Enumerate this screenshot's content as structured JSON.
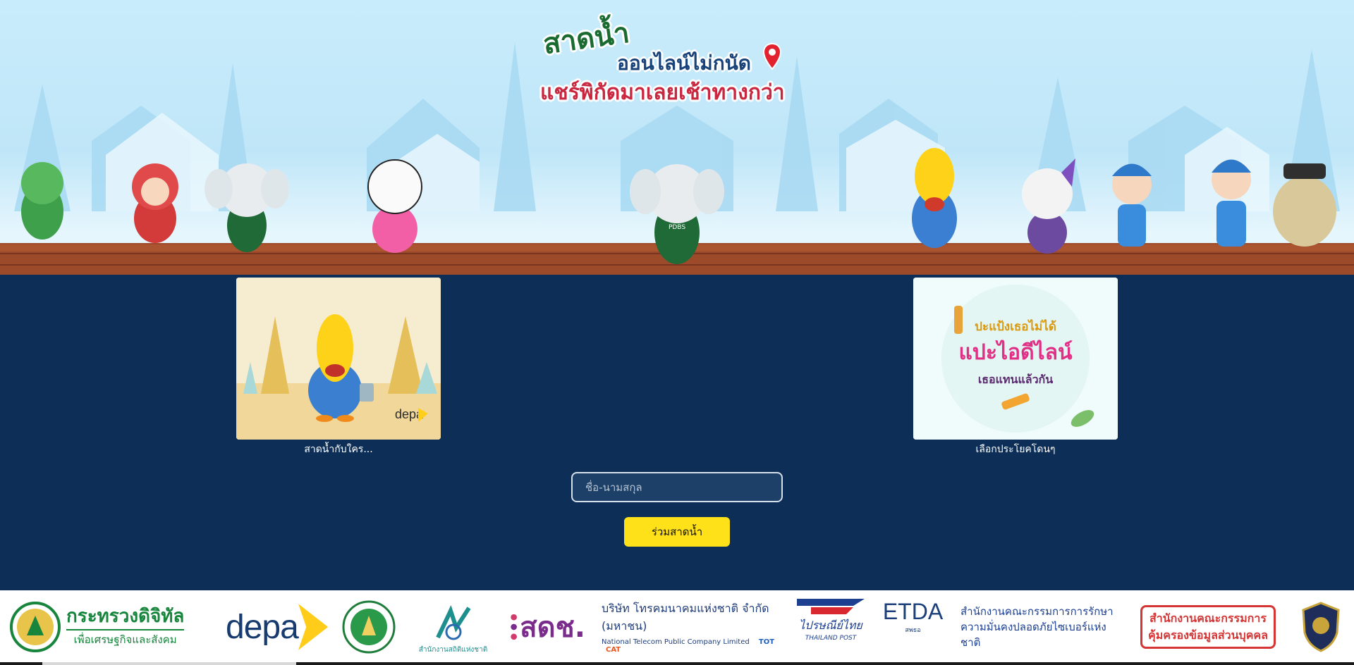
{
  "banner": {
    "title_line_1": "สาดน้ำ",
    "title_line_2": "ออนไลน์ไม่กนัด",
    "title_line_3": "แชร์พิกัดมาเลยเช้าทางกว่า",
    "pin_icon": "location-pin-icon",
    "mascot_badge": "PDBS"
  },
  "cards": [
    {
      "caption": "สาดน้ำกับใคร...",
      "logo_text": "depa"
    },
    {
      "caption": "เลือกประโยคโดนๆ",
      "art_line_1": "ปะแป้งเธอไม่ได้",
      "art_line_2": "แปะไอดีไลน์",
      "art_line_3": "เธอแทนแล้วกัน"
    }
  ],
  "form": {
    "name_placeholder": "ชื่อ-นามสกุล",
    "name_value": "",
    "submit_label": "ร่วมสาดน้ำ"
  },
  "footer": {
    "mdes_name": "กระทรวงดิจิทัล",
    "mdes_sub": "เพื่อเศรษฐกิจและสังคม",
    "depa_name": "depa",
    "nso_name": "สำนักงานสถิติแห่งชาติ",
    "tsri_name": "สดช.",
    "nt_name_th": "บริษัท โทรคมนาคมแห่งชาติ จำกัด (มหาชน)",
    "nt_name_en": "National Telecom Public Company Limited",
    "nt_tot": "TOT",
    "nt_cat": "CAT",
    "post_name_th": "ไปรษณีย์ไทย",
    "post_name_en": "THAILAND POST",
    "etda_name": "ETDA",
    "etda_sub": "สพธอ",
    "ncsa_line_1": "สำนักงานคณะกรรมการการรักษา",
    "ncsa_line_2": "ความมั่นคงปลอดภัยไซเบอร์แห่งชาติ",
    "pdpc_line_1": "สำนักงานคณะกรรมการ",
    "pdpc_line_2": "คุ้มครองข้อมูลส่วนบุคคล"
  },
  "colors": {
    "page_background": "#0d2f57",
    "button_yellow": "#ffe11a",
    "banner_sky": "#c9ecfb",
    "mdes_green": "#17853c",
    "pdpc_red": "#d53535"
  }
}
